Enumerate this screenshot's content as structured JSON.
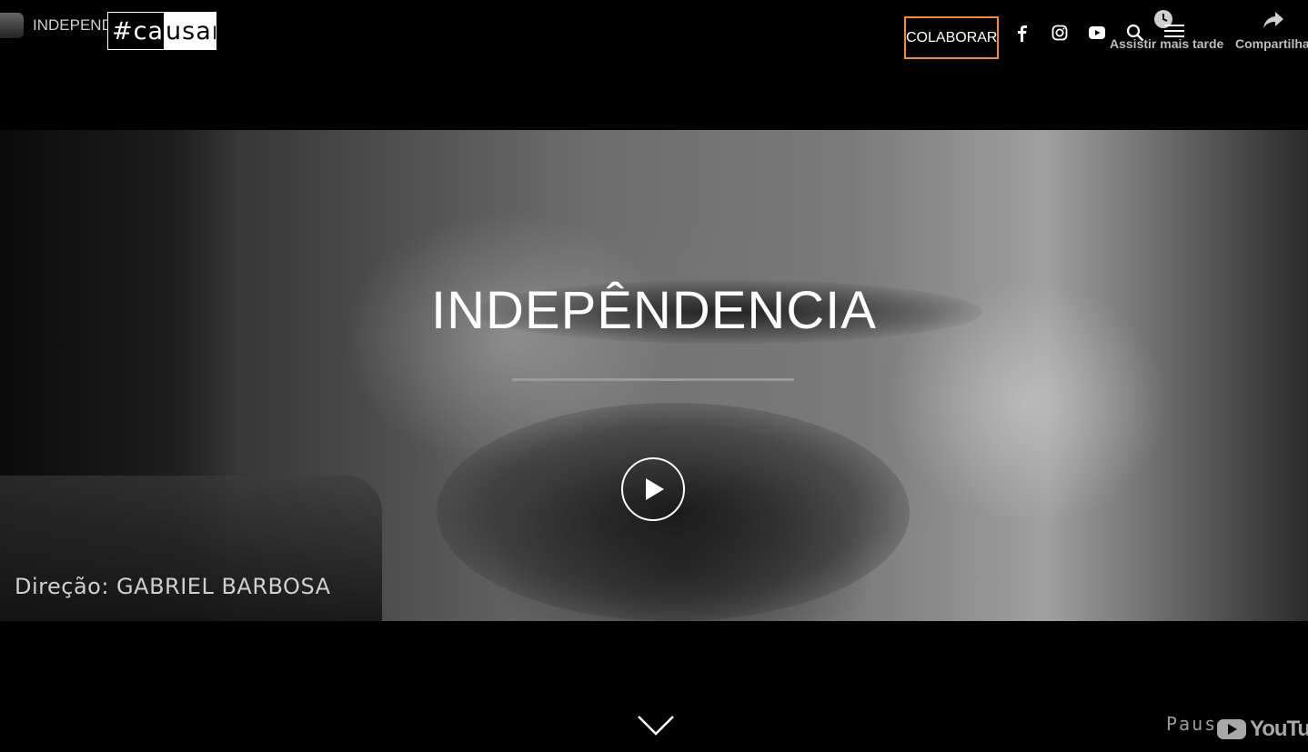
{
  "youtube_bar": {
    "video_title": "INDEPENDÊNCIA",
    "watch_later_label": "Assistir mais tarde",
    "share_label": "Compartilhar"
  },
  "header": {
    "logo": {
      "part1": "#ca",
      "part2": "usar"
    },
    "colaborar_label": "COLABORAR",
    "social_icons": [
      "facebook-icon",
      "instagram-icon",
      "youtube-icon"
    ],
    "search_icon": "search-icon",
    "menu_icon": "hamburger-menu-icon",
    "accent_color": "#f28c28"
  },
  "hero": {
    "title": "INDEPÊNDENCIA",
    "credit": "Direção:  GABRIEL  BARBOSA",
    "play_icon": "play-icon",
    "scroll_icon": "chevron-down-icon"
  },
  "player_controls": {
    "pause_label": "Pause",
    "brand": "YouTube"
  }
}
